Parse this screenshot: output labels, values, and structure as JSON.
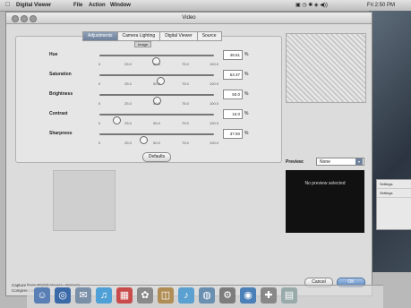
{
  "menubar": {
    "app_name": "Digital Viewer",
    "menus": [
      "File",
      "Action",
      "Window"
    ],
    "status_extras": "",
    "clock": "Fri 2:50 PM"
  },
  "window": {
    "title": "Video"
  },
  "tabs": [
    {
      "label": "Adjustments",
      "active": true
    },
    {
      "label": "Camera Lighting",
      "active": false
    },
    {
      "label": "Digital Viewer",
      "active": false
    },
    {
      "label": "Source",
      "active": false
    }
  ],
  "subtab": "Image",
  "ticks": [
    "0",
    "25.0",
    "50.0",
    "75.0",
    "100.0"
  ],
  "sliders": [
    {
      "label": "Hue",
      "value": "48.61",
      "fraction": 0.49
    },
    {
      "label": "Saturation",
      "value": "53.37",
      "fraction": 0.53
    },
    {
      "label": "Brightness",
      "value": "50.0",
      "fraction": 0.5
    },
    {
      "label": "Contrast",
      "value": "15.0",
      "fraction": 0.15
    },
    {
      "label": "Sharpness",
      "value": "37.50",
      "fraction": 0.38
    }
  ],
  "unit": "%",
  "defaults_label": "Defaults",
  "preview": {
    "label": "Preview:",
    "value": "None",
    "message": "No preview selected"
  },
  "status": {
    "line1": "Capture from: Digital Viewer - Camera",
    "line2": "Compress with: None"
  },
  "buttons": {
    "cancel": "Cancel",
    "ok": "OK"
  },
  "side_panel": {
    "item1": "Settings",
    "item2": "Settings"
  },
  "dock_icons": [
    "finder-icon",
    "safari-icon",
    "mail-icon",
    "itunes-icon",
    "ical-icon",
    "photo-icon",
    "address-book-icon",
    "itunes-note-icon",
    "preview-icon",
    "system-prefs-icon",
    "quicktime-icon",
    "grab-icon",
    "trash-icon"
  ]
}
